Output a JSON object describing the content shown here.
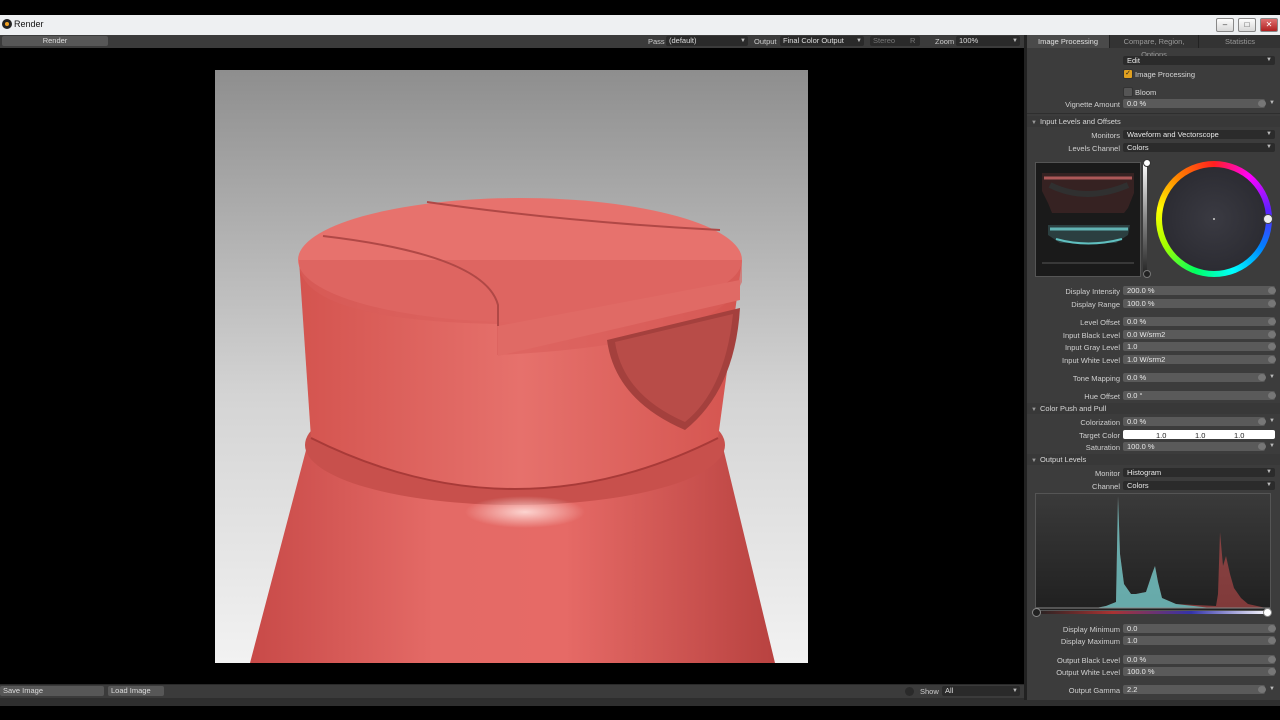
{
  "window": {
    "title": "Render",
    "controls": [
      "–",
      "□",
      "✕"
    ]
  },
  "toolbar": {
    "render_button": "Render",
    "pass_label": "Pass",
    "pass_value": "(default)",
    "output_label": "Output",
    "output_value": "Final Color Output",
    "stereo_label": "Stereo",
    "stereo_channel": "R",
    "zoom_label": "Zoom",
    "zoom_value": "100%"
  },
  "bottom": {
    "save_image": "Save Image",
    "load_image": "Load Image",
    "show_label": "Show",
    "show_value": "All"
  },
  "panel": {
    "tabs": [
      "Image Processing",
      "Compare, Region, Options",
      "Statistics"
    ],
    "active_tab": 0,
    "edit_select": "Edit",
    "image_processing_label": "Image Processing",
    "image_processing_checked": true,
    "bloom_label": "Bloom",
    "bloom_checked": false,
    "vignette": {
      "label": "Vignette Amount",
      "value": "0.0 %"
    },
    "input_levels": {
      "title": "Input Levels and Offsets",
      "monitors_label": "Monitors",
      "monitors_value": "Waveform and Vectorscope",
      "levels_channel_label": "Levels Channel",
      "levels_channel_value": "Colors",
      "display_intensity": {
        "label": "Display Intensity",
        "value": "200.0 %"
      },
      "display_range": {
        "label": "Display Range",
        "value": "100.0 %"
      },
      "level_offset": {
        "label": "Level Offset",
        "value": "0.0 %"
      },
      "input_black": {
        "label": "Input Black Level",
        "value": "0.0 W/srm2"
      },
      "input_gray": {
        "label": "Input Gray Level",
        "value": "1.0"
      },
      "input_white": {
        "label": "Input White Level",
        "value": "1.0 W/srm2"
      },
      "tone_mapping": {
        "label": "Tone Mapping",
        "value": "0.0 %"
      },
      "hue_offset": {
        "label": "Hue Offset",
        "value": "0.0 °"
      }
    },
    "color_push": {
      "title": "Color Push and Pull",
      "colorization": {
        "label": "Colorization",
        "value": "0.0 %"
      },
      "target_color": {
        "label": "Target Color",
        "r": "1.0",
        "g": "1.0",
        "b": "1.0"
      },
      "saturation": {
        "label": "Saturation",
        "value": "100.0 %"
      }
    },
    "output_levels": {
      "title": "Output Levels",
      "monitor_label": "Monitor",
      "monitor_value": "Histogram",
      "channel_label": "Channel",
      "channel_value": "Colors",
      "display_min": {
        "label": "Display Minimum",
        "value": "0.0"
      },
      "display_max": {
        "label": "Display Maximum",
        "value": "1.0"
      },
      "output_black": {
        "label": "Output Black Level",
        "value": "0.0 %"
      },
      "output_white": {
        "label": "Output White Level",
        "value": "100.0 %"
      },
      "output_gamma": {
        "label": "Output Gamma",
        "value": "2.2"
      }
    }
  },
  "colors": {
    "accent": "#e0a020",
    "bottle": "#e0625f",
    "histogram_cyan": "#5fd0d0",
    "histogram_red": "#d05050"
  }
}
